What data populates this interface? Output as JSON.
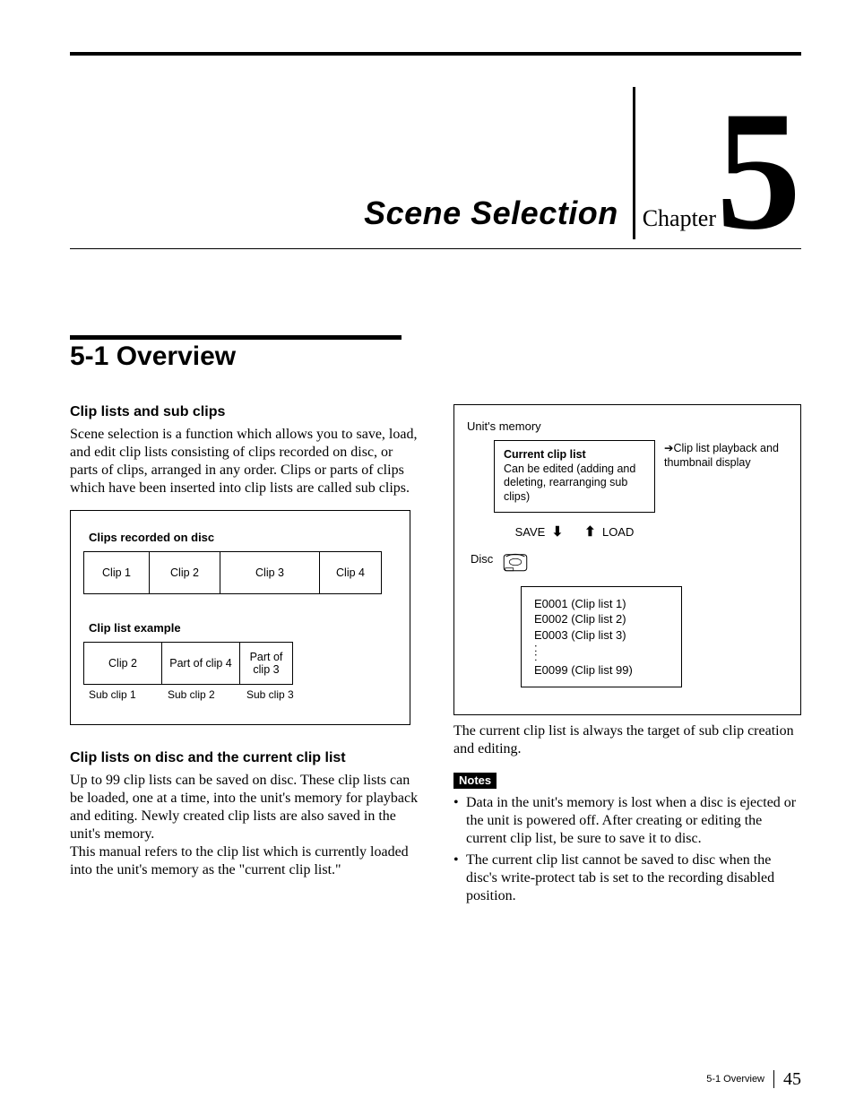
{
  "chapter": {
    "title": "Scene Selection",
    "word": "Chapter",
    "number": "5"
  },
  "section": {
    "number": "5-1",
    "title": "Overview"
  },
  "left": {
    "subhead1": "Clip lists and sub clips",
    "para1": "Scene selection is a function which allows you to save, load, and edit clip lists consisting of clips recorded on disc, or parts of clips, arranged in any order. Clips or parts of clips which have been inserted into clip lists are called sub clips.",
    "fig1": {
      "caption_a": "Clips recorded on disc",
      "cells_a": [
        "Clip 1",
        "Clip 2",
        "Clip 3",
        "Clip 4"
      ],
      "caption_b": "Clip list example",
      "cells_b": [
        "Clip 2",
        "Part of clip 4",
        "Part of clip 3"
      ],
      "sub_labels": [
        "Sub clip 1",
        "Sub clip 2",
        "Sub clip 3"
      ]
    },
    "subhead2": "Clip lists on disc and the current clip list",
    "para2": "Up to 99 clip lists can be saved on disc. These clip lists can be loaded, one at a time, into the unit's memory for playback and editing. Newly created clip lists are also saved in the unit's memory.",
    "para3": "This manual refers to the clip list which is currently loaded into the unit's memory as the \"current clip list.\""
  },
  "right": {
    "fig2": {
      "mem_label": "Unit's memory",
      "box_title": "Current clip list",
      "box_body": "Can be edited (adding and deleting, rearranging sub clips)",
      "side_text": "Clip list playback and thumbnail display",
      "save": "SAVE",
      "load": "LOAD",
      "disc": "Disc",
      "list_items": [
        "E0001 (Clip list 1)",
        "E0002 (Clip list 2)",
        "E0003 (Clip list 3)"
      ],
      "list_last": "E0099 (Clip list 99)"
    },
    "para1": "The current clip list is always the target of sub clip creation and editing.",
    "notes_label": "Notes",
    "notes": [
      "Data in the unit's memory is lost when a disc is ejected or the unit is powered off. After creating or editing the current clip list, be sure to save it to disc.",
      "The current clip list cannot be saved to disc when the disc's write-protect tab is set to the recording disabled position."
    ]
  },
  "footer": {
    "section": "5-1 Overview",
    "page": "45"
  }
}
